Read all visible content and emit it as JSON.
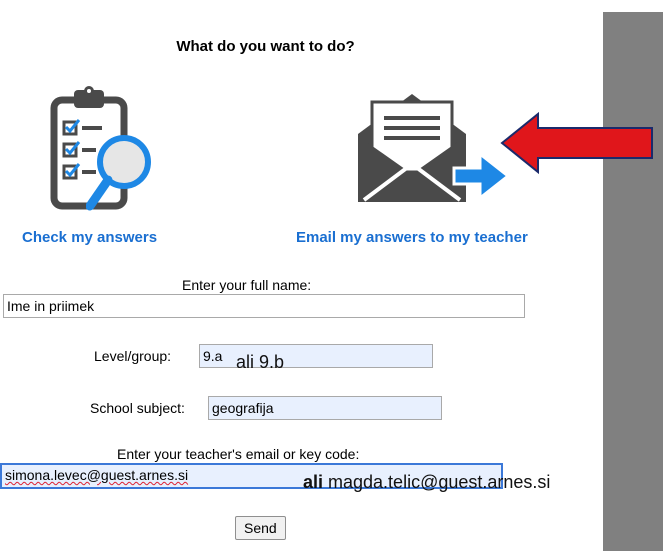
{
  "heading": "What do you want to do?",
  "options": {
    "check_label": "Check my answers",
    "email_label": "Email my answers to my teacher"
  },
  "form": {
    "name_label": "Enter your full name:",
    "name_value": "Ime in priimek",
    "level_label": "Level/group:",
    "level_value": "9.a",
    "level_note": "ali 9.b",
    "subject_label": "School subject:",
    "subject_value": "geografija",
    "email_label": "Enter your teacher's email or key code:",
    "email_value": "simona.levec@guest.arnes.si",
    "email_note_bold": "ali",
    "email_note_rest": " magda.telic@guest.arnes.si",
    "send_label": "Send"
  },
  "colors": {
    "link": "#1a6fd1",
    "icon_gray": "#4a4a4a",
    "icon_blue": "#1e88e5",
    "arrow_red": "#e0161b",
    "sidebar": "#808080"
  },
  "icons": [
    "clipboard-checklist-icon",
    "magnifier-icon",
    "envelope-send-icon",
    "red-arrow-annotation"
  ]
}
